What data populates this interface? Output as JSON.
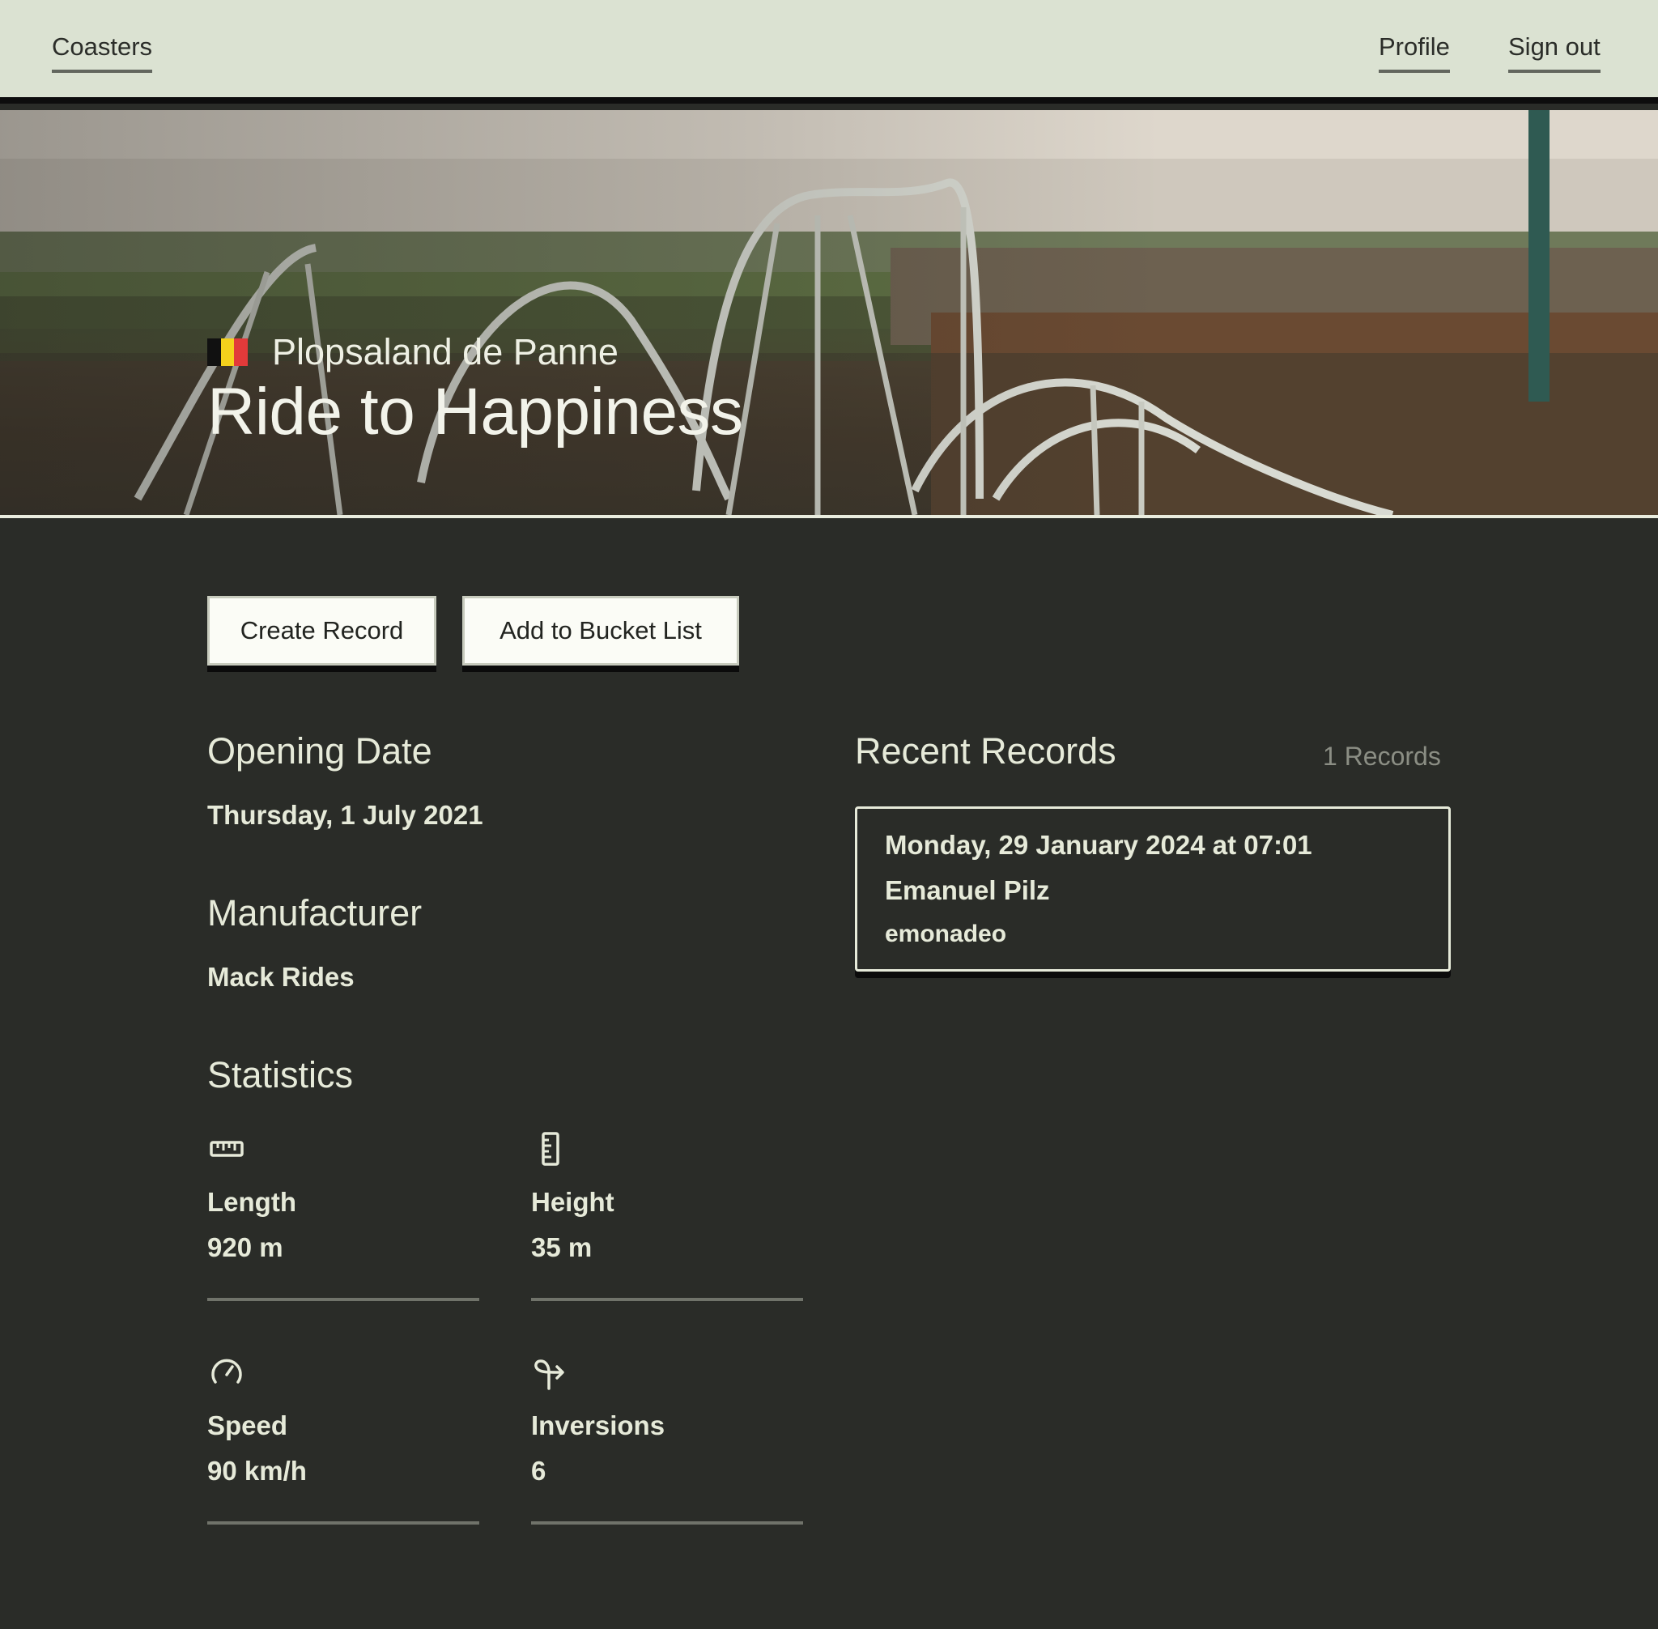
{
  "nav": {
    "home_label": "Coasters",
    "profile_label": "Profile",
    "signout_label": "Sign out"
  },
  "hero": {
    "park_name": "Plopsaland de Panne",
    "ride_name": "Ride to Happiness",
    "flag_colors": [
      "#111111",
      "#f4d11c",
      "#e23a3a"
    ]
  },
  "actions": {
    "create_record": "Create Record",
    "add_bucket": "Add to Bucket List"
  },
  "details": {
    "opening_date_title": "Opening Date",
    "opening_date_value": "Thursday, 1 July 2021",
    "manufacturer_title": "Manufacturer",
    "manufacturer_value": "Mack Rides",
    "statistics_title": "Statistics"
  },
  "stats": [
    {
      "icon": "ruler-horizontal-icon",
      "label": "Length",
      "value": "920 m"
    },
    {
      "icon": "ruler-vertical-icon",
      "label": "Height",
      "value": "35 m"
    },
    {
      "icon": "speedometer-icon",
      "label": "Speed",
      "value": "90 km/h"
    },
    {
      "icon": "loop-arrow-icon",
      "label": "Inversions",
      "value": "6"
    }
  ],
  "records": {
    "title": "Recent Records",
    "count_label": "1 Records",
    "items": [
      {
        "datetime": "Monday, 29 January 2024 at 07:01",
        "name": "Emanuel Pilz",
        "username": "emonadeo"
      }
    ]
  },
  "colors": {
    "nav_bg": "#dbe2d2",
    "page_bg": "#2a2c28",
    "text": "#e6ead9",
    "button_bg": "#fbfcf6"
  }
}
